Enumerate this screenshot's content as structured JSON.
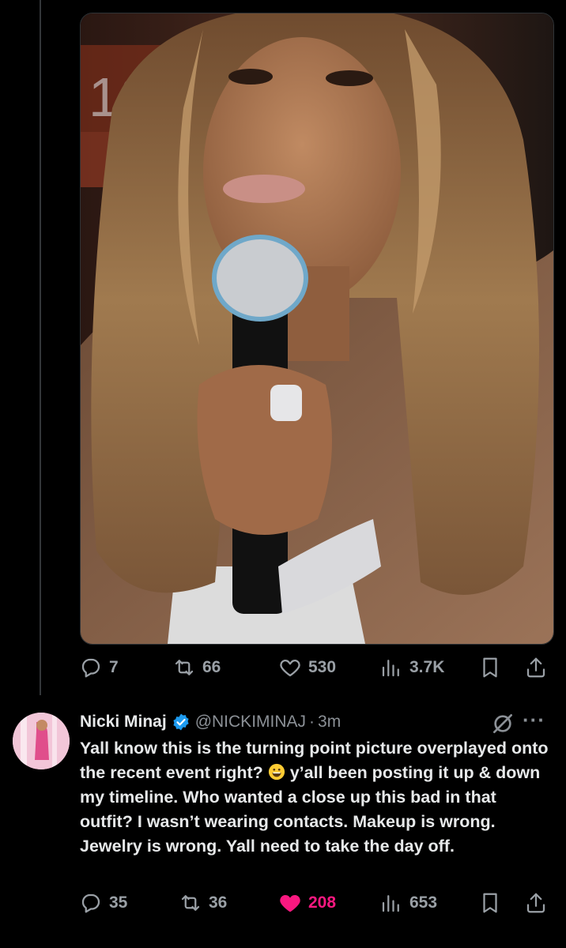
{
  "post1": {
    "actions": {
      "replies": "7",
      "reposts": "66",
      "likes": "530",
      "views": "3.7K"
    }
  },
  "post2": {
    "author_name": "Nicki Minaj",
    "handle": "@NICKIMINAJ",
    "separator": "·",
    "time": "3m",
    "more": "···",
    "text_before_emoji": "Yall know this is the turning point picture overplayed onto the recent event right? ",
    "text_after_emoji": " y’all been posting it up & down my timeline. Who wanted a close up this bad in that outfit? I wasn’t wearing contacts. Makeup is wrong. Jewelry is wrong. Yall need to take the day off.",
    "actions": {
      "replies": "35",
      "reposts": "36",
      "likes": "208",
      "views": "653"
    }
  },
  "colors": {
    "background": "#000000",
    "text": "#e7e9ea",
    "muted": "#8b9096",
    "like": "#f91880",
    "verified": "#1d9bf0"
  }
}
